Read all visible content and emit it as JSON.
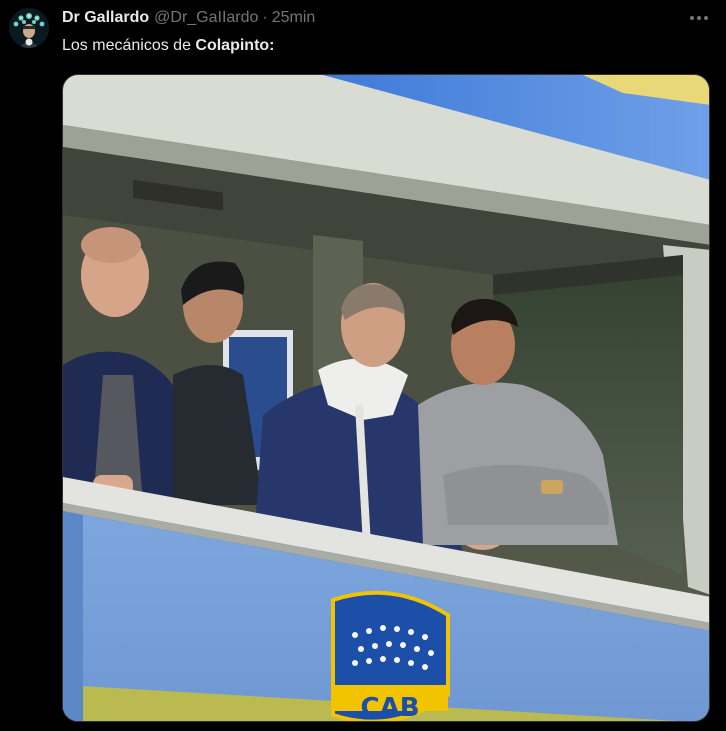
{
  "author": {
    "display_name": "Dr Gallardo",
    "handle": "@Dr_GaIIardo",
    "separator": "·",
    "time": "25min"
  },
  "tweet": {
    "text_prefix": "Los mecánicos de ",
    "text_bold": "Colapinto:"
  },
  "icons": {
    "more": "more-horizontal-icon",
    "avatar": "avatar-illustration"
  },
  "colors": {
    "background": "#000000",
    "text_primary": "#e7e9ea",
    "text_secondary": "#71767b",
    "boca_blue": "#1b4fa8",
    "boca_gold": "#f2c300"
  }
}
